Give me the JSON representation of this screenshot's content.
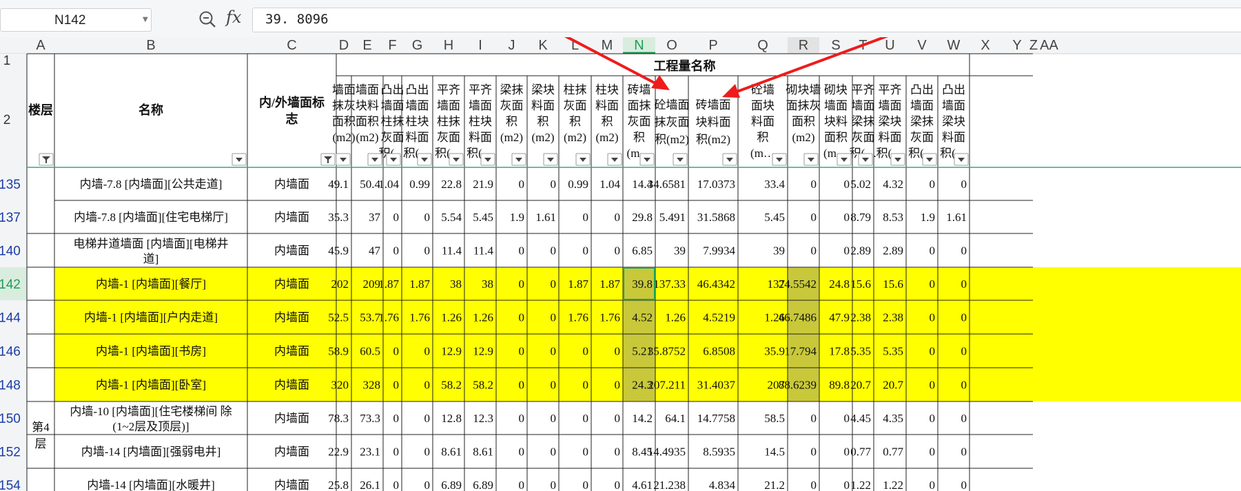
{
  "formula_bar": {
    "name_box": "N142",
    "fx_label": "fx",
    "zoom_icon": "zoom-icon",
    "formula": "39. 8096"
  },
  "columns": [
    "A",
    "B",
    "C",
    "D",
    "E",
    "F",
    "G",
    "H",
    "I",
    "J",
    "K",
    "L",
    "M",
    "N",
    "O",
    "P",
    "Q",
    "R",
    "S",
    "T",
    "U",
    "V",
    "W",
    "X",
    "Y",
    "Z",
    "AA"
  ],
  "selected_column": "N",
  "selected_row": "142",
  "header": {
    "floor_label": "楼层",
    "name_label": "名称",
    "wall_flag_label": [
      "内/外墙面标",
      "志"
    ],
    "group_title": "工程量名称",
    "quantity_columns": [
      [
        "墙面",
        "抹灰",
        "面积",
        "(m2)"
      ],
      [
        "墙面",
        "块料",
        "面积",
        "(m2)"
      ],
      [
        "凸出",
        "墙面",
        "柱抹",
        "灰面",
        "积(…"
      ],
      [
        "凸出",
        "墙面",
        "柱块",
        "料面",
        "积(…"
      ],
      [
        "平齐",
        "墙面",
        "柱抹",
        "灰面",
        "积(…"
      ],
      [
        "平齐",
        "墙面",
        "柱块",
        "料面",
        "积(…"
      ],
      [
        "梁抹",
        "灰面",
        "积",
        "(m2)"
      ],
      [
        "梁块",
        "料面",
        "积",
        "(m2)"
      ],
      [
        "柱抹",
        "灰面",
        "积",
        "(m2)"
      ],
      [
        "柱块",
        "料面",
        "积",
        "(m2)"
      ],
      [
        "砖墙",
        "面抹",
        "灰面",
        "积",
        "(m…"
      ],
      [
        "砼墙面",
        "抹灰面",
        "积(m2)"
      ],
      [
        "砖墙面",
        "块料面",
        "积(m2)"
      ],
      [
        "砼墙",
        "面块",
        "料面",
        "积",
        "(m…"
      ],
      [
        "砌块墙",
        "面抹灰",
        "面积",
        "(m2)"
      ],
      [
        "砌块",
        "墙面",
        "块料",
        "面积",
        "(m…"
      ],
      [
        "平齐",
        "墙面",
        "梁抹",
        "灰面",
        "积(…"
      ],
      [
        "平齐",
        "墙面",
        "梁块",
        "料面",
        "积(…"
      ],
      [
        "凸出",
        "墙面",
        "梁抹",
        "灰面",
        "积(…"
      ],
      [
        "凸出",
        "墙面",
        "梁块",
        "料面",
        "积(…"
      ]
    ]
  },
  "rows": [
    {
      "row_num": "135",
      "name": [
        "内墙-7.8 [内墙面][公共走道]"
      ],
      "type": "内墙面",
      "values": [
        "49.1",
        "50.4",
        "1.04",
        "0.99",
        "22.8",
        "21.9",
        "0",
        "0",
        "0.99",
        "1.04",
        "14.4",
        "34.6581",
        "17.0373",
        "33.4",
        "0",
        "0",
        "5.02",
        "4.32",
        "0",
        "0"
      ],
      "highlight": false
    },
    {
      "row_num": "137",
      "name": [
        "内墙-7.8 [内墙面][住宅电梯厅]"
      ],
      "type": "内墙面",
      "values": [
        "35.3",
        "37",
        "0",
        "0",
        "5.54",
        "5.45",
        "1.9",
        "1.61",
        "0",
        "0",
        "29.8",
        "5.491",
        "31.5868",
        "5.45",
        "0",
        "0",
        "8.79",
        "8.53",
        "1.9",
        "1.61"
      ],
      "highlight": false
    },
    {
      "row_num": "140",
      "name": [
        "电梯井道墙面 [内墙面][电梯井",
        "道]"
      ],
      "type": "内墙面",
      "values": [
        "45.9",
        "47",
        "0",
        "0",
        "11.4",
        "11.4",
        "0",
        "0",
        "0",
        "0",
        "6.85",
        "39",
        "7.9934",
        "39",
        "0",
        "0",
        "2.89",
        "2.89",
        "0",
        "0"
      ],
      "highlight": false
    },
    {
      "row_num": "142",
      "name": [
        "内墙-1 [内墙面][餐厅]"
      ],
      "type": "内墙面",
      "values": [
        "202",
        "209",
        "1.87",
        "1.87",
        "38",
        "38",
        "0",
        "0",
        "1.87",
        "1.87",
        "39.8",
        "137.33",
        "46.4342",
        "137",
        "24.5542",
        "24.8",
        "15.6",
        "15.6",
        "0",
        "0"
      ],
      "highlight": true
    },
    {
      "row_num": "144",
      "name": [
        "内墙-1 [内墙面][户内走道]"
      ],
      "type": "内墙面",
      "values": [
        "52.5",
        "53.7",
        "1.76",
        "1.76",
        "1.26",
        "1.26",
        "0",
        "0",
        "1.76",
        "1.76",
        "4.52",
        "1.26",
        "4.5219",
        "1.26",
        "46.7486",
        "47.9",
        "2.38",
        "2.38",
        "0",
        "0"
      ],
      "highlight": true
    },
    {
      "row_num": "146",
      "name": [
        "内墙-1 [内墙面][书房]"
      ],
      "type": "内墙面",
      "values": [
        "58.9",
        "60.5",
        "0",
        "0",
        "12.9",
        "12.9",
        "0",
        "0",
        "0",
        "0",
        "5.21",
        "35.8752",
        "6.8508",
        "35.9",
        "17.794",
        "17.8",
        "5.35",
        "5.35",
        "0",
        "0"
      ],
      "highlight": true
    },
    {
      "row_num": "148",
      "name": [
        "内墙-1 [内墙面][卧室]"
      ],
      "type": "内墙面",
      "values": [
        "320",
        "328",
        "0",
        "0",
        "58.2",
        "58.2",
        "0",
        "0",
        "0",
        "0",
        "24.3",
        "207.211",
        "31.4037",
        "207",
        "88.6239",
        "89.8",
        "20.7",
        "20.7",
        "0",
        "0"
      ],
      "highlight": true
    },
    {
      "row_num": "150",
      "name": [
        "内墙-10 [内墙面][住宅楼梯间 除",
        "(1~2层及顶层)]"
      ],
      "type": "内墙面",
      "values": [
        "78.3",
        "73.3",
        "0",
        "0",
        "12.8",
        "12.3",
        "0",
        "0",
        "0",
        "0",
        "14.2",
        "64.1",
        "14.7758",
        "58.5",
        "0",
        "0",
        "4.45",
        "4.35",
        "0",
        "0"
      ],
      "highlight": false
    },
    {
      "row_num": "152",
      "name": [
        "内墙-14 [内墙面][强弱电井]"
      ],
      "type": "内墙面",
      "values": [
        "22.9",
        "23.1",
        "0",
        "0",
        "8.61",
        "8.61",
        "0",
        "0",
        "0",
        "0",
        "8.45",
        "14.4935",
        "8.5935",
        "14.5",
        "0",
        "0",
        "0.77",
        "0.77",
        "0",
        "0"
      ],
      "highlight": false
    },
    {
      "row_num": "154",
      "name": [
        "内墙-14 [内墙面][水暖井]"
      ],
      "type": "内墙面",
      "values": [
        "25.8",
        "26.1",
        "0",
        "0",
        "6.89",
        "6.89",
        "0",
        "0",
        "0",
        "0",
        "4.61",
        "21.238",
        "4.834",
        "21.2",
        "0",
        "0",
        "1.22",
        "1.22",
        "0",
        "0"
      ],
      "highlight": false
    }
  ],
  "floor_value": [
    "第4",
    "层"
  ],
  "colors": {
    "highlight": "#ffff00",
    "selected_fill": "#c8c83a",
    "select_border": "#1f9d55",
    "arrow": "#ee1c1c"
  }
}
